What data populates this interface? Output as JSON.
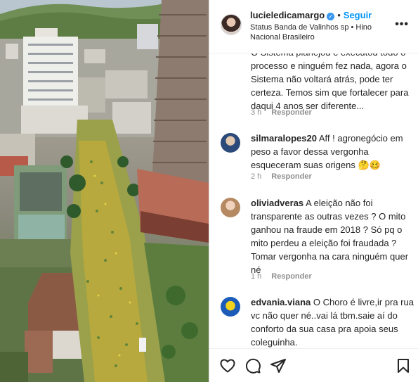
{
  "post": {
    "username": "lucieledicamargo",
    "separator": "•",
    "follow_label": "Seguir",
    "music": "Status Banda de Valinhos sp • Hino Nacional Brasileiro",
    "more_label": "•••"
  },
  "comments": [
    {
      "username": "",
      "text": "O Sistema planejou e executou todo o processo e ninguém fez nada, agora o Sistema não voltará atrás, pode ter certeza. Temos sim que fortalecer para daqui 4 anos ser diferente...",
      "time": "3 h",
      "reply_label": "Responder"
    },
    {
      "username": "silmaralopes20",
      "text": "Aff ! agronegócio em peso a favor dessa vergonha esqueceram suas origens 🤔🥴",
      "time": "2 h",
      "reply_label": "Responder"
    },
    {
      "username": "oliviadveras",
      "text": "A eleição não foi transparente as outras vezes ? O mito ganhou na fraude em 2018 ? Só pq o mito perdeu a eleição foi fraudada ? Tomar vergonha na cara ninguém quer né",
      "time": "1 h",
      "reply_label": "Responder"
    },
    {
      "username": "edvania.viana",
      "text": "O Choro é livre,ir pra rua vc não quer né..vai lá tbm.saie aí do conforto da sua casa pra apoia seus coleguinha.",
      "time": "",
      "reply_label": ""
    }
  ],
  "icons": {
    "like": "heart-icon",
    "comment": "comment-icon",
    "share": "paper-plane-icon",
    "save": "bookmark-icon",
    "verified": "verified-badge-icon"
  },
  "colors": {
    "link_blue": "#0095f6",
    "muted": "#8e8e8e",
    "text": "#262626"
  }
}
